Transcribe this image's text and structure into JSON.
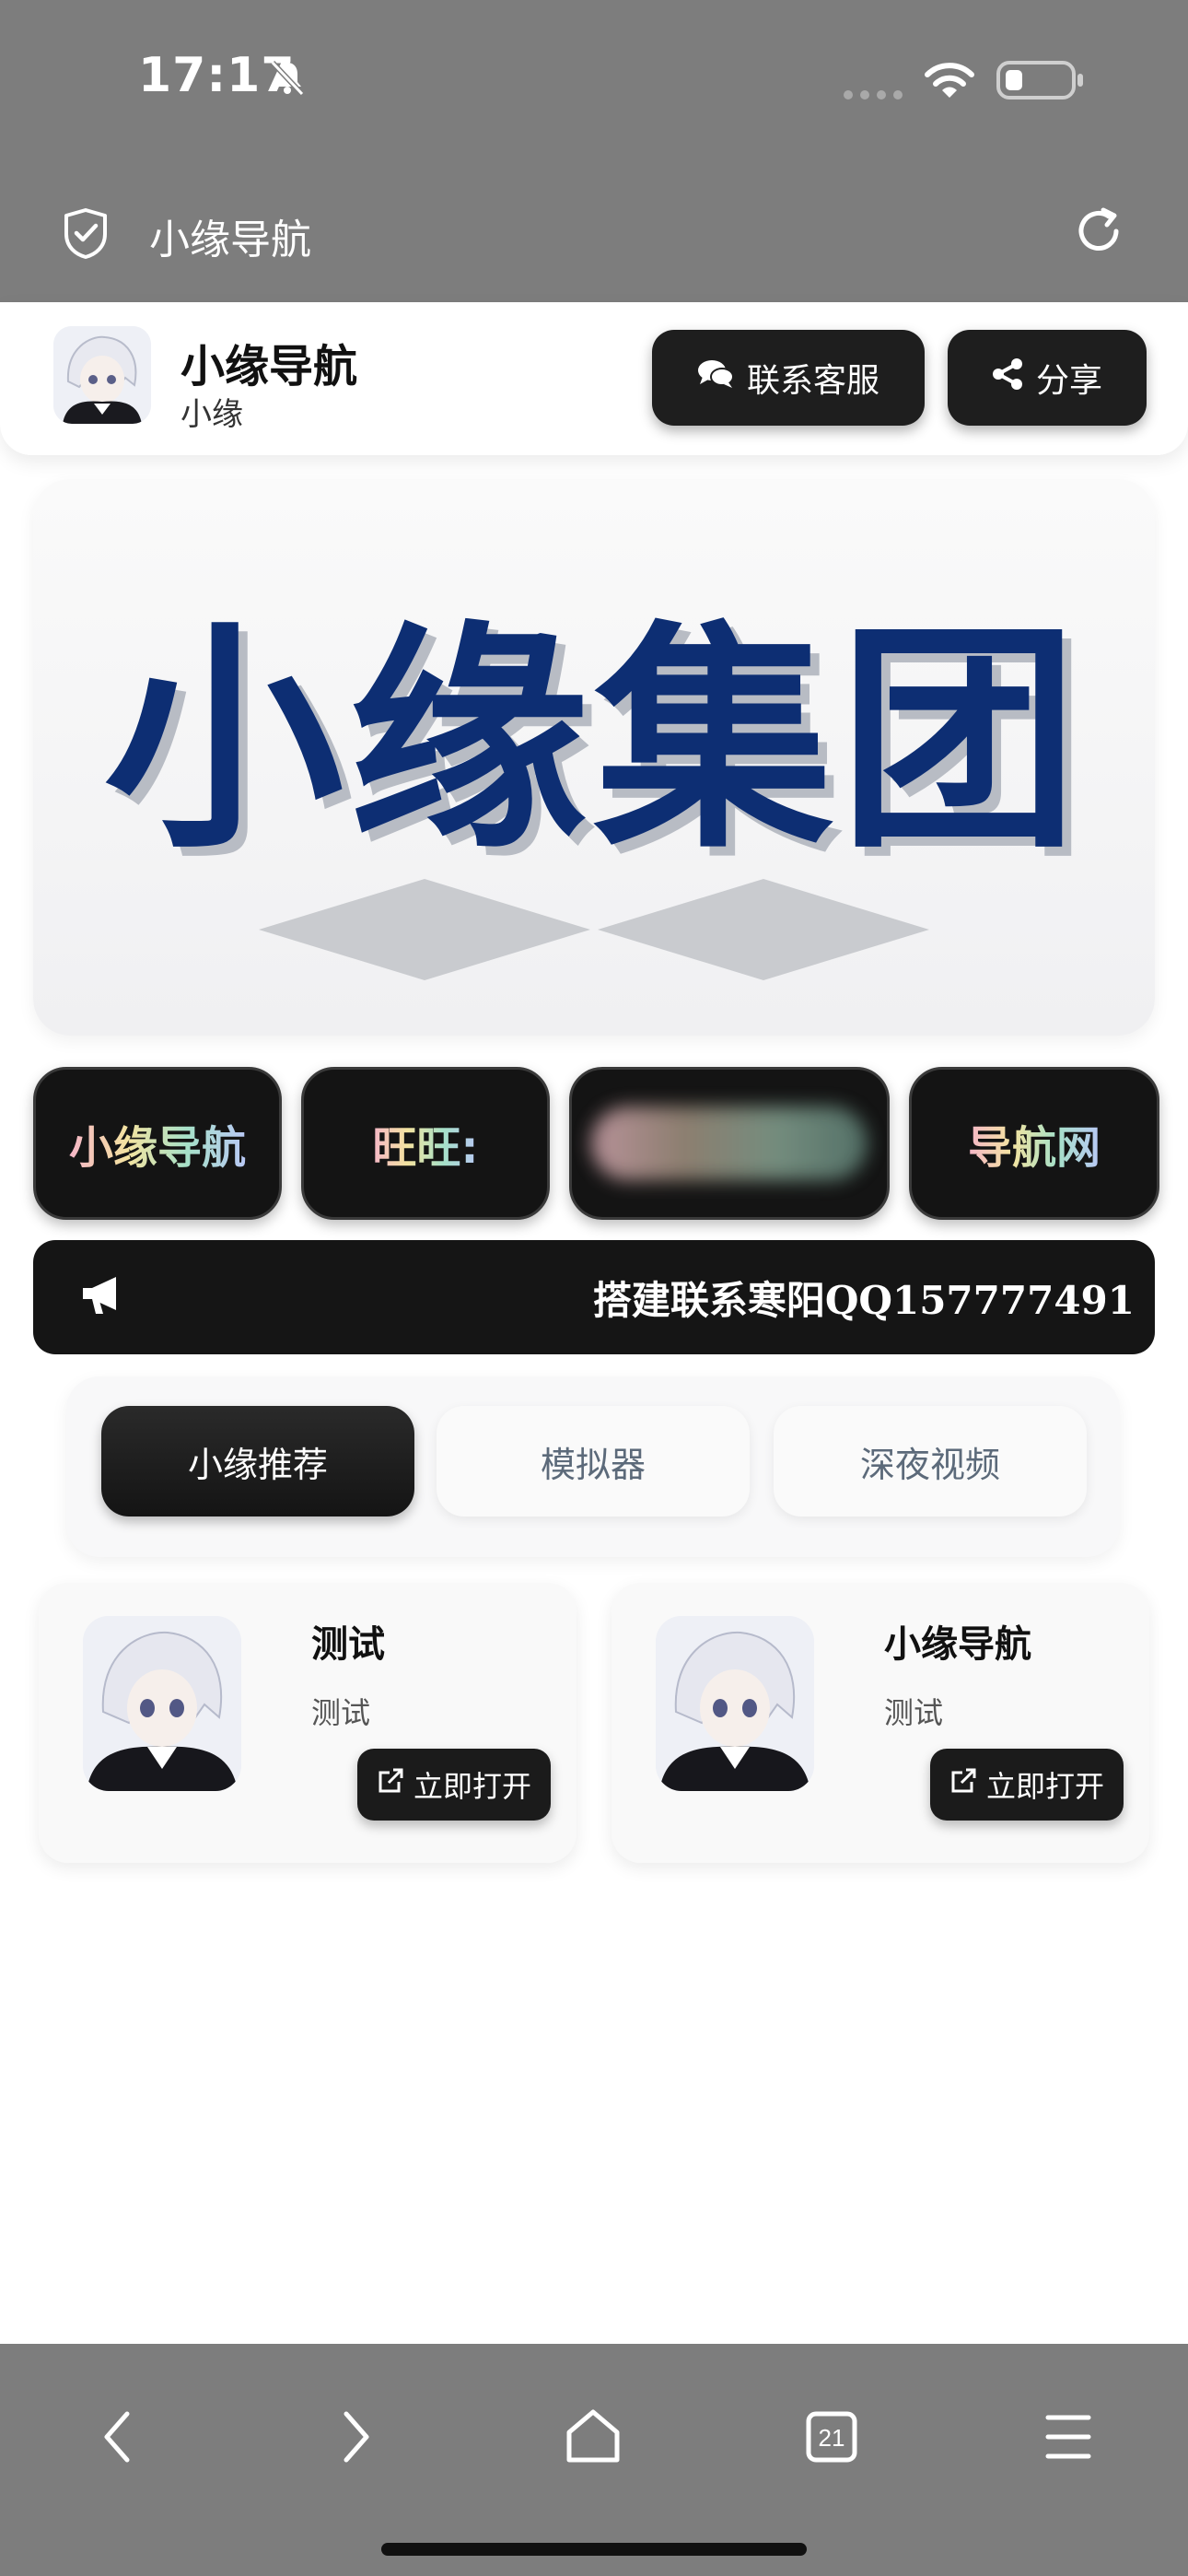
{
  "status_bar": {
    "time": "17:17",
    "icons": [
      "bell-off-icon",
      "signal-icon",
      "wifi-icon",
      "battery-icon"
    ]
  },
  "browser": {
    "page_title": "小缘导航",
    "icons": [
      "shield-check-icon",
      "reload-icon"
    ]
  },
  "header": {
    "title": "小缘导航",
    "subtitle": "小缘",
    "contact_label": "联系客服",
    "share_label": "分享"
  },
  "banner": {
    "text": "小缘集团",
    "text_color": "#0d2e73"
  },
  "chips": [
    {
      "label": "小缘导航"
    },
    {
      "label": "旺旺:"
    },
    {
      "label": ""
    },
    {
      "label": "导航网"
    }
  ],
  "notice": {
    "text": "搭建联系寒阳QQ157777491"
  },
  "tabs": [
    {
      "label": "小缘推荐",
      "active": true
    },
    {
      "label": "模拟器",
      "active": false
    },
    {
      "label": "深夜视频",
      "active": false
    }
  ],
  "cards": [
    {
      "title": "测试",
      "desc": "测试",
      "button": "立即打开"
    },
    {
      "title": "小缘导航",
      "desc": "测试",
      "button": "立即打开"
    }
  ],
  "bottom_nav": {
    "tab_count": "21",
    "icons": [
      "back-icon",
      "forward-icon",
      "home-icon",
      "tabs-icon",
      "menu-icon"
    ]
  }
}
